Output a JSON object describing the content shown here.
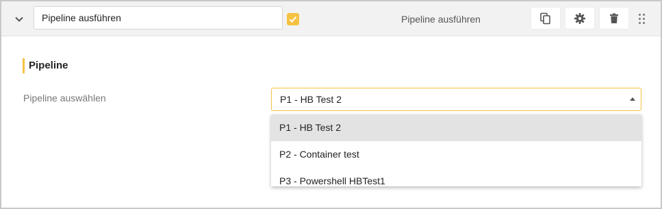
{
  "header": {
    "name_value": "Pipeline ausführen",
    "enabled_checked": true,
    "title": "Pipeline ausführen",
    "icons": {
      "collapse": "chevron-down-icon",
      "enabled": "checkbox-checked-icon",
      "copy": "copy-icon",
      "settings": "gear-icon",
      "delete": "trash-icon",
      "drag": "drag-handle-icon"
    }
  },
  "section": {
    "title": "Pipeline",
    "field_label": "Pipeline auswählen",
    "selected_value": "P1 - HB Test 2",
    "options": [
      {
        "label": "P1 - HB Test 2",
        "selected": true
      },
      {
        "label": "P2 - Container test",
        "selected": false
      },
      {
        "label": "P3 - Powershell HBTest1",
        "selected": false
      }
    ]
  },
  "colors": {
    "accent": "#f5c242",
    "header_bg": "#f2f2f2",
    "selected_option_bg": "#e3e3e3",
    "label": "#777777"
  }
}
